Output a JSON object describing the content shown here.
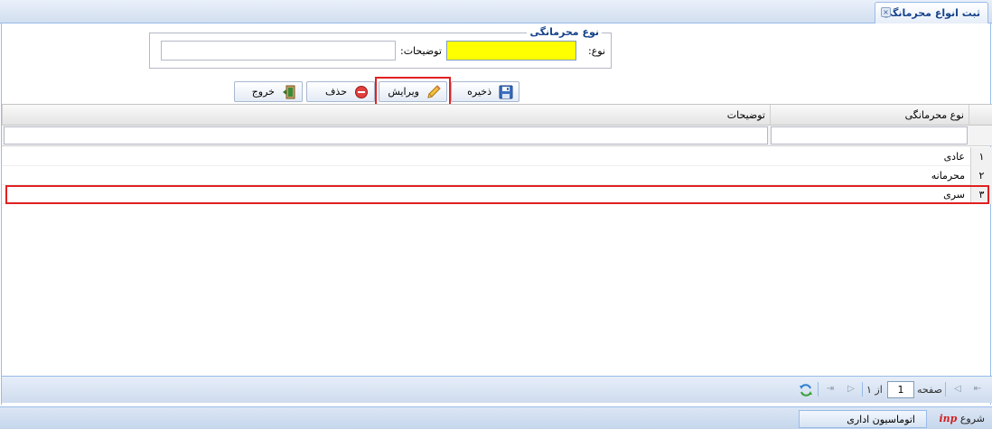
{
  "tab": {
    "title": "ثبت انواع محرمانگی",
    "close_glyph": "×"
  },
  "form": {
    "legend": "نوع محرمانگی",
    "type_label": "نوع:",
    "type_value": "",
    "desc_label": "توضیحات:",
    "desc_value": ""
  },
  "toolbar": {
    "save_label": "ذخیره",
    "edit_label": "ویرایش",
    "delete_label": "حذف",
    "exit_label": "خروج"
  },
  "grid": {
    "columns": [
      "نوع محرمانگی",
      "توضیحات"
    ],
    "rows": [
      {
        "num": "۱",
        "type": "عادی",
        "desc": ""
      },
      {
        "num": "۲",
        "type": "محرمانه",
        "desc": ""
      },
      {
        "num": "۳",
        "type": "سری",
        "desc": ""
      }
    ]
  },
  "paging": {
    "page_label": "صفحه",
    "page_value": "1",
    "of_label": "از ۱"
  },
  "taskbar": {
    "start_label": "شروع",
    "logo_text": "inp",
    "task_label": "اتوماسیون اداری"
  },
  "colors": {
    "highlight": "#e02020",
    "required_field": "#ffff00",
    "accent": "#15428b"
  }
}
